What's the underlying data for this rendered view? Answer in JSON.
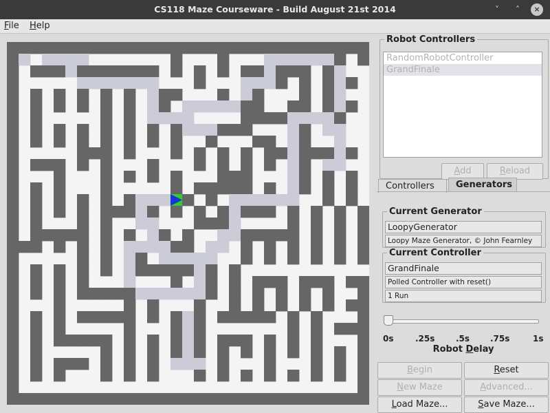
{
  "window": {
    "title": "CS118 Maze Courseware - Build August 21st 2014",
    "minimize_glyph": "˅",
    "maximize_glyph": "˄",
    "close_glyph": "×"
  },
  "menubar": {
    "file": {
      "mnemonic": "F",
      "rest": "ile"
    },
    "help": {
      "mnemonic": "H",
      "rest": "elp"
    }
  },
  "maze": {
    "colors": {
      "wall": "#666666",
      "floor": "#f4f4f4",
      "path": "#ccccd9",
      "robot_fill": "#1a35d6",
      "robot_bg": "#33cc33"
    },
    "cells": 31,
    "rows": [
      "###############################",
      "#P.PPPP.......#...#...PPPPPP#.#",
      "#.###P#######.#.#.#.##P###.#P..",
      "#.....PPPPPPP...#...PPP#.#.#P#.",
      "#.#.#.#.#.#.P##...#.P#...#.#P..",
      "#.#.#.#.#.#.P#.PPPPP##..##.#P#.",
      "#.#.....#.#.PPPP....####PPPP#..",
      "#.#.#.#.#.#.#.#PPP###...P#.PP..",
      "#.#.#.#.#.#.#.#..#...##.P#..P..",
      "#.....###.#...#.#.#.#.##P###P#.",
      "#.###.#.#...#...#.#.#.#.P#.PP..",
      "#...#...#.#.#.#...###...P#.#.#.",
      "#.#.#...#.....#.#####.#.P#.#.#.",
      "#.#.#.#.#.#PPPR#.#.PPPPPP..#.#.",
      "#.#.#.#.###P#.#.#.#P###.#.#.#.#",
      "#.#...#.#..PP...###P....#.#.#.#",
      "#.#####.#.#.P#.#..PP#####.#.#.#",
      "###.#.#.#.PPPP##.PP.#.#.#.#.#.#",
      "#.....#.#.P#.PPPPP..#.#.#.#.#.#",
      "#.#.#.#.#.P#####P#.#...........",
      "#.#.#.#...P...#.P#.#.###.###.##",
      "#.#.#.#####PPPPPP#.#.#.#.#.#..#",
      "#...#.....#.#...#..#.#.#.#.#.##",
      "#.#.#.#####.#.#P#.#####.#.#...#",
      "#.#.#.....#...#P#.......#.#.###",
      "#.#.#####.#.#.#P#.###.#.#.#...#",
      "#.#.....#.#.#.#P#.#.#.#.#.#.#.#",
      "#.#.###.#.#.#.PPP.#...#...#.#.#",
      "#.#.#...#.#.#...#.#.#.#.#.#.#.#",
      "#.............................#",
      "###############################"
    ]
  },
  "panel": {
    "robot_controllers": {
      "legend": "Robot Controllers",
      "items": [
        "RandomRobotController",
        "GrandFinale"
      ],
      "add": {
        "mnemonic": "A",
        "rest": "dd"
      },
      "reload": {
        "mnemonic": "R",
        "rest": "eload"
      }
    },
    "tabs": {
      "controllers": "Controllers",
      "generators": "Generators"
    },
    "current_generator": {
      "legend": "Current Generator",
      "name": "LoopyGenerator",
      "description": "Loopy Maze Generator, © John Fearnley"
    },
    "current_controller": {
      "legend": "Current Controller",
      "name": "GrandFinale",
      "description": "Polled Controller with reset()",
      "runs": "1 Run"
    },
    "slider": {
      "value": 0,
      "ticks": [
        "0s",
        ".25s",
        ".5s",
        ".75s",
        "1s"
      ],
      "label_pre": "Robot ",
      "label_mnemonic": "D",
      "label_post": "elay"
    },
    "buttons": {
      "begin": {
        "mnemonic": "B",
        "rest": "egin"
      },
      "reset": {
        "mnemonic": "R",
        "rest": "eset"
      },
      "new_maze": {
        "mnemonic": "N",
        "rest": "ew Maze"
      },
      "advanced": {
        "mnemonic": "A",
        "rest": "dvanced..."
      },
      "load_maze": {
        "pre": "",
        "mnemonic": "L",
        "rest": "oad Maze..."
      },
      "save_maze": {
        "pre": "",
        "mnemonic": "S",
        "rest": "ave Maze..."
      }
    }
  }
}
